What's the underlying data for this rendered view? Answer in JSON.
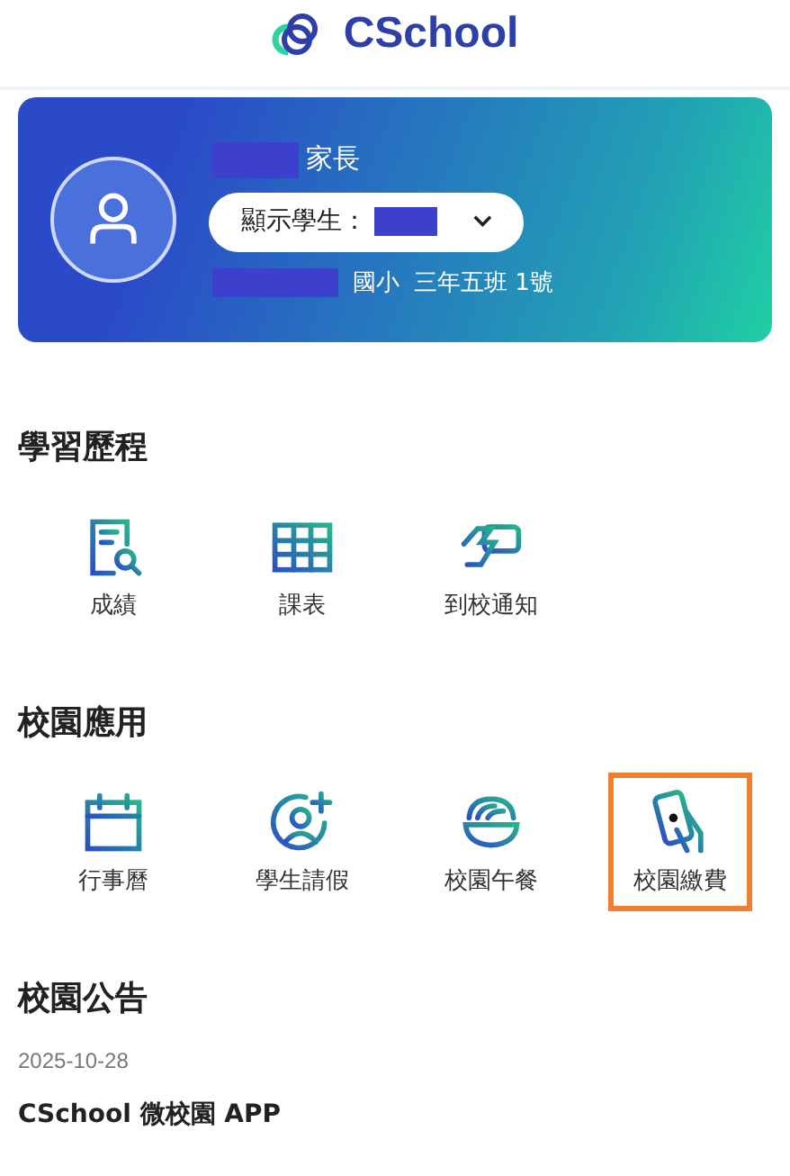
{
  "app_bar": {
    "title": "CSchool"
  },
  "profile": {
    "role": "家長",
    "student_label": "顯示學生：",
    "school": "國小",
    "class_info": "三年五班 1號"
  },
  "sections": [
    {
      "title": "學習歷程",
      "items": [
        {
          "label": "成績",
          "kind": "report",
          "highlighted": false
        },
        {
          "label": "課表",
          "kind": "timetable",
          "highlighted": false
        },
        {
          "label": "到校通知",
          "kind": "card",
          "highlighted": false
        }
      ]
    },
    {
      "title": "校園應用",
      "items": [
        {
          "label": "行事曆",
          "kind": "calendar",
          "highlighted": false
        },
        {
          "label": "學生請假",
          "kind": "leave",
          "highlighted": false
        },
        {
          "label": "校園午餐",
          "kind": "lunch",
          "highlighted": false
        },
        {
          "label": "校園繳費",
          "kind": "payment",
          "highlighted": true
        }
      ]
    }
  ],
  "announcements": {
    "title": "校園公告",
    "items": [
      {
        "date": "2025-10-28",
        "title": "CSchool 微校園 APP"
      }
    ]
  }
}
